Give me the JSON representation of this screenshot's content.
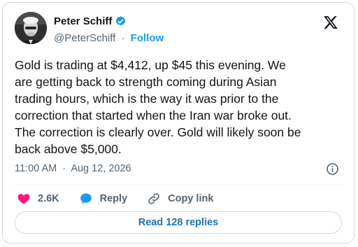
{
  "author": {
    "name": "Peter Schiff",
    "handle": "@PeterSchiff",
    "separator": "·",
    "follow_label": "Follow",
    "verified_color": "#1d9bf0"
  },
  "brand_icon": "x-logo",
  "tweet": {
    "text": "Gold is trading at $4,412, up $45 this evening. We\nare getting back to strength coming during Asian\ntrading hours, which is the way it was prior to the\ncorrection that started when the Iran war broke out.\nThe correction is clearly over. Gold will likely soon be\nback above $5,000.",
    "time": "11:00 AM",
    "date_separator": "·",
    "date": "Aug 12, 2026"
  },
  "actions": {
    "likes_count": "2.6K",
    "reply_label": "Reply",
    "copy_link_label": "Copy link",
    "like_color": "#f91880",
    "reply_color": "#1d9bf0"
  },
  "replies_button": {
    "label": "Read 128 replies"
  }
}
